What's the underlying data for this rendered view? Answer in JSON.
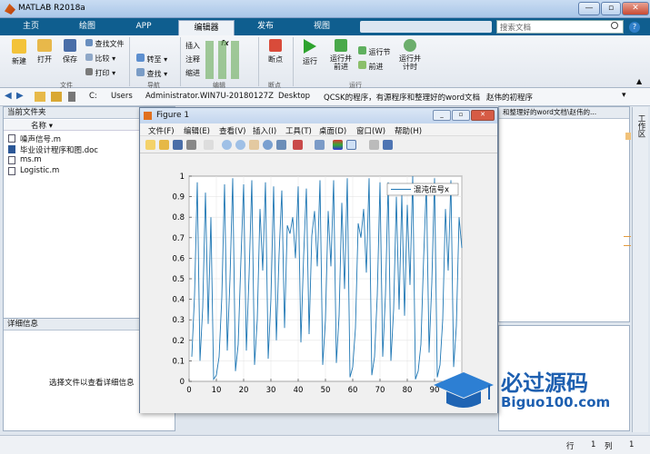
{
  "window": {
    "title": "MATLAB R2018a",
    "search_placeholder": "搜索文档"
  },
  "tabs": [
    "主页",
    "绘图",
    "APP",
    "编辑器",
    "发布",
    "视图"
  ],
  "active_tab": "编辑器",
  "ribbon": {
    "file": {
      "new": "新建",
      "open": "打开",
      "save": "保存",
      "find_files": "查找文件",
      "compare": "比较",
      "print": "打印",
      "section": "文件"
    },
    "nav": {
      "goto": "转至",
      "find": "查找",
      "section": "导航"
    },
    "edit": {
      "insert": "插入",
      "comment": "注释",
      "indent": "缩进",
      "fx": "fx",
      "section": "编辑"
    },
    "breakpoints": {
      "label": "断点",
      "section": "断点"
    },
    "run": {
      "run": "运行",
      "run_advance": "运行并\n前进",
      "run_section": "运行节",
      "advance": "前进",
      "run_time": "运行并\n计时",
      "section": "运行"
    }
  },
  "address": {
    "crumbs": [
      "C:",
      "Users",
      "Administrator.WIN7U-20180127Z",
      "Desktop",
      "QCSK的程序，有源程序和整理好的word文档",
      "赵伟的初程序"
    ],
    "right_crumb": "和整理好的word文档\\赵伟的..."
  },
  "current_folder": {
    "title": "当前文件夹",
    "col_name": "名称 ▾",
    "files": [
      "噪声信号.m",
      "毕业设计程序和图.doc",
      "ms.m",
      "Logistic.m"
    ]
  },
  "details": {
    "title": "详细信息",
    "empty_msg": "选择文件以查看详细信息"
  },
  "right_tab": "工作区",
  "figure": {
    "title": "Figure 1",
    "menu": [
      "文件(F)",
      "编辑(E)",
      "查看(V)",
      "插入(I)",
      "工具(T)",
      "桌面(D)",
      "窗口(W)",
      "帮助(H)"
    ],
    "legend": "混沌信号x"
  },
  "chart_data": {
    "type": "line",
    "xlim": [
      0,
      100
    ],
    "ylim": [
      0,
      1
    ],
    "xticks": [
      0,
      10,
      20,
      30,
      40,
      50,
      60,
      70,
      80,
      90,
      100
    ],
    "yticks": [
      0,
      0.1,
      0.2,
      0.3,
      0.4,
      0.5,
      0.6,
      0.7,
      0.8,
      0.9,
      1
    ],
    "series": [
      {
        "name": "混沌信号x",
        "color": "#1f77b4",
        "x": [
          1,
          2,
          3,
          4,
          5,
          6,
          7,
          8,
          9,
          10,
          11,
          12,
          13,
          14,
          15,
          16,
          17,
          18,
          19,
          20,
          21,
          22,
          23,
          24,
          25,
          26,
          27,
          28,
          29,
          30,
          31,
          32,
          33,
          34,
          35,
          36,
          37,
          38,
          39,
          40,
          41,
          42,
          43,
          44,
          45,
          46,
          47,
          48,
          49,
          50,
          51,
          52,
          53,
          54,
          55,
          56,
          57,
          58,
          59,
          60,
          61,
          62,
          63,
          64,
          65,
          66,
          67,
          68,
          69,
          70,
          71,
          72,
          73,
          74,
          75,
          76,
          77,
          78,
          79,
          80,
          81,
          82,
          83,
          84,
          85,
          86,
          87,
          88,
          89,
          90,
          91,
          92,
          93,
          94,
          95,
          96,
          97,
          98,
          99,
          100
        ],
        "y": [
          0.12,
          0.42,
          0.97,
          0.1,
          0.36,
          0.92,
          0.28,
          0.8,
          0.01,
          0.03,
          0.12,
          0.41,
          0.96,
          0.15,
          0.5,
          0.99,
          0.05,
          0.18,
          0.59,
          0.96,
          0.15,
          0.52,
          0.98,
          0.08,
          0.3,
          0.84,
          0.54,
          0.97,
          0.11,
          0.4,
          0.95,
          0.2,
          0.62,
          0.93,
          0.26,
          0.76,
          0.72,
          0.8,
          0.6,
          0.95,
          0.19,
          0.61,
          0.94,
          0.23,
          0.71,
          0.83,
          0.56,
          0.98,
          0.08,
          0.3,
          0.83,
          0.56,
          0.98,
          0.09,
          0.32,
          0.87,
          0.45,
          0.99,
          0.02,
          0.07,
          0.26,
          0.77,
          0.7,
          0.84,
          0.53,
          0.99,
          0.03,
          0.12,
          0.42,
          0.97,
          0.12,
          0.42,
          0.97,
          0.1,
          0.35,
          0.9,
          0.35,
          0.91,
          0.32,
          0.86,
          0.47,
          1.0,
          0.01,
          0.05,
          0.18,
          0.6,
          0.96,
          0.14,
          0.48,
          0.99,
          0.02,
          0.08,
          0.3,
          0.84,
          0.54,
          0.98,
          0.07,
          0.27,
          0.8,
          0.65
        ]
      }
    ]
  },
  "watermark": {
    "cn": "必过源码",
    "en": "Biguo100.com"
  },
  "status": {
    "row_label": "行",
    "row": "1",
    "col_label": "列",
    "col": "1"
  }
}
